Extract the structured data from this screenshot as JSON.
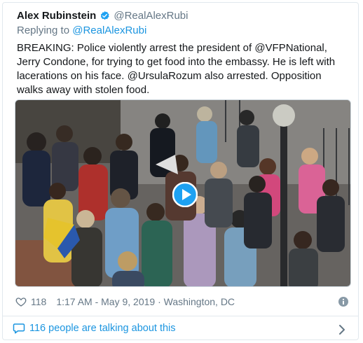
{
  "tweet": {
    "author_name": "Alex Rubinstein",
    "author_handle": "@RealAlexRubi",
    "replying_prefix": "Replying to ",
    "replying_to": "@RealAlexRubi",
    "text": "BREAKING: Police violently arrest the president of @VFPNational, Jerry Condone, for trying to get food into the embassy. He is left with lacerations on his face. @UrsulaRozum also arrested. Opposition walks away with stolen food.",
    "like_count": "118",
    "timestamp": "1:17 AM - May 9, 2019 · Washington, DC",
    "talking_text": "116 people are talking about this"
  },
  "colors": {
    "accent": "#1b95e0",
    "muted": "#657786",
    "border": "#e1e8ed"
  },
  "icons": {
    "verified": "verified-badge-icon",
    "like": "heart-icon",
    "info": "info-icon",
    "conversation": "speech-bubble-icon",
    "chevron": "chevron-right-icon",
    "play": "play-icon"
  }
}
